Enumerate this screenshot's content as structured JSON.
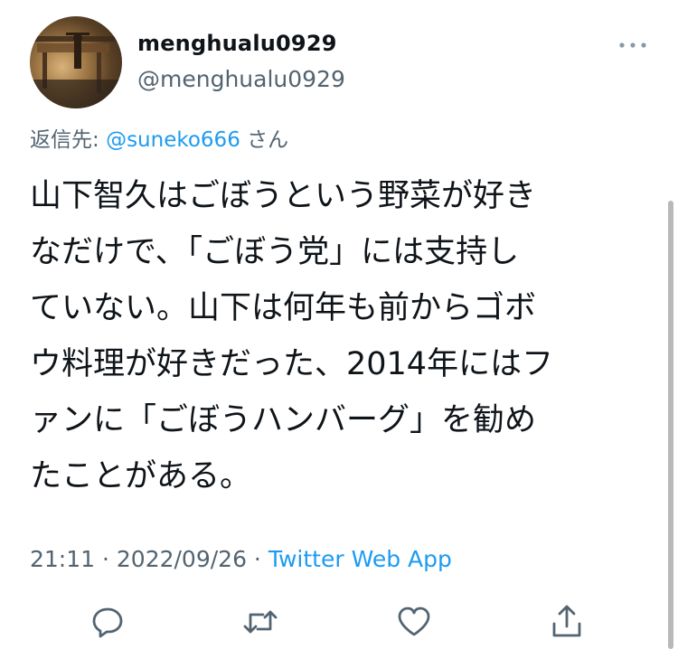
{
  "author": {
    "display_name": "menghualu0929",
    "handle": "@menghualu0929",
    "avatar_icon": "avatar-photo-icon"
  },
  "reply_to": {
    "prefix": "返信先: ",
    "mention": "@suneko666",
    "suffix": " さん"
  },
  "tweet": {
    "text": "山下智久はごぼうという野菜が好き\nなだけで、「ごぼう党」には支持し\nていない。山下は何年も前からゴボ\nウ料理が好きだった、2014年にはフ\nァンに「ごぼうハンバーグ」を勧め\nたことがある。"
  },
  "meta": {
    "time": "21:11",
    "separator": " · ",
    "date": "2022/09/26",
    "source": "Twitter Web App"
  },
  "actions": {
    "reply_icon": "reply-icon",
    "retweet_icon": "retweet-icon",
    "like_icon": "like-icon",
    "share_icon": "share-icon",
    "more_icon": "more-icon"
  },
  "colors": {
    "link": "#1d9bf0",
    "secondary_text": "#536471",
    "primary_text": "#0f1419"
  }
}
